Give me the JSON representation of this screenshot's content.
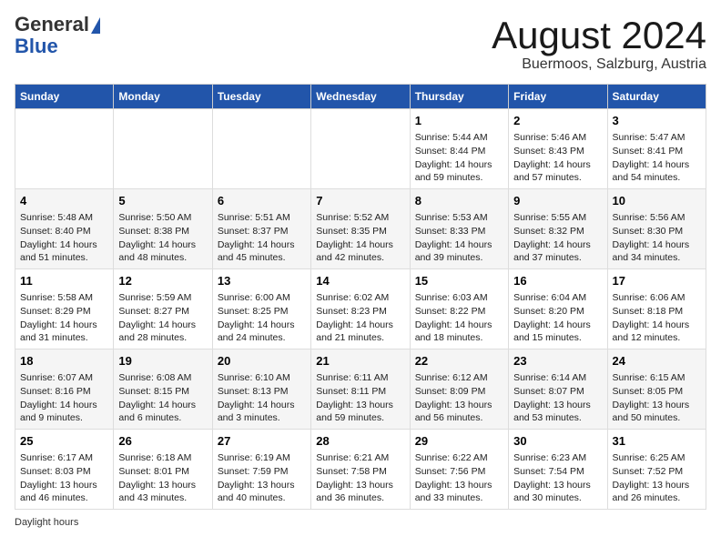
{
  "logo": {
    "general": "General",
    "blue": "Blue"
  },
  "title": "August 2024",
  "subtitle": "Buermoos, Salzburg, Austria",
  "days_of_week": [
    "Sunday",
    "Monday",
    "Tuesday",
    "Wednesday",
    "Thursday",
    "Friday",
    "Saturday"
  ],
  "footer_text": "Daylight hours",
  "weeks": [
    [
      {
        "day": "",
        "info": ""
      },
      {
        "day": "",
        "info": ""
      },
      {
        "day": "",
        "info": ""
      },
      {
        "day": "",
        "info": ""
      },
      {
        "day": "1",
        "info": "Sunrise: 5:44 AM\nSunset: 8:44 PM\nDaylight: 14 hours and 59 minutes."
      },
      {
        "day": "2",
        "info": "Sunrise: 5:46 AM\nSunset: 8:43 PM\nDaylight: 14 hours and 57 minutes."
      },
      {
        "day": "3",
        "info": "Sunrise: 5:47 AM\nSunset: 8:41 PM\nDaylight: 14 hours and 54 minutes."
      }
    ],
    [
      {
        "day": "4",
        "info": "Sunrise: 5:48 AM\nSunset: 8:40 PM\nDaylight: 14 hours and 51 minutes."
      },
      {
        "day": "5",
        "info": "Sunrise: 5:50 AM\nSunset: 8:38 PM\nDaylight: 14 hours and 48 minutes."
      },
      {
        "day": "6",
        "info": "Sunrise: 5:51 AM\nSunset: 8:37 PM\nDaylight: 14 hours and 45 minutes."
      },
      {
        "day": "7",
        "info": "Sunrise: 5:52 AM\nSunset: 8:35 PM\nDaylight: 14 hours and 42 minutes."
      },
      {
        "day": "8",
        "info": "Sunrise: 5:53 AM\nSunset: 8:33 PM\nDaylight: 14 hours and 39 minutes."
      },
      {
        "day": "9",
        "info": "Sunrise: 5:55 AM\nSunset: 8:32 PM\nDaylight: 14 hours and 37 minutes."
      },
      {
        "day": "10",
        "info": "Sunrise: 5:56 AM\nSunset: 8:30 PM\nDaylight: 14 hours and 34 minutes."
      }
    ],
    [
      {
        "day": "11",
        "info": "Sunrise: 5:58 AM\nSunset: 8:29 PM\nDaylight: 14 hours and 31 minutes."
      },
      {
        "day": "12",
        "info": "Sunrise: 5:59 AM\nSunset: 8:27 PM\nDaylight: 14 hours and 28 minutes."
      },
      {
        "day": "13",
        "info": "Sunrise: 6:00 AM\nSunset: 8:25 PM\nDaylight: 14 hours and 24 minutes."
      },
      {
        "day": "14",
        "info": "Sunrise: 6:02 AM\nSunset: 8:23 PM\nDaylight: 14 hours and 21 minutes."
      },
      {
        "day": "15",
        "info": "Sunrise: 6:03 AM\nSunset: 8:22 PM\nDaylight: 14 hours and 18 minutes."
      },
      {
        "day": "16",
        "info": "Sunrise: 6:04 AM\nSunset: 8:20 PM\nDaylight: 14 hours and 15 minutes."
      },
      {
        "day": "17",
        "info": "Sunrise: 6:06 AM\nSunset: 8:18 PM\nDaylight: 14 hours and 12 minutes."
      }
    ],
    [
      {
        "day": "18",
        "info": "Sunrise: 6:07 AM\nSunset: 8:16 PM\nDaylight: 14 hours and 9 minutes."
      },
      {
        "day": "19",
        "info": "Sunrise: 6:08 AM\nSunset: 8:15 PM\nDaylight: 14 hours and 6 minutes."
      },
      {
        "day": "20",
        "info": "Sunrise: 6:10 AM\nSunset: 8:13 PM\nDaylight: 14 hours and 3 minutes."
      },
      {
        "day": "21",
        "info": "Sunrise: 6:11 AM\nSunset: 8:11 PM\nDaylight: 13 hours and 59 minutes."
      },
      {
        "day": "22",
        "info": "Sunrise: 6:12 AM\nSunset: 8:09 PM\nDaylight: 13 hours and 56 minutes."
      },
      {
        "day": "23",
        "info": "Sunrise: 6:14 AM\nSunset: 8:07 PM\nDaylight: 13 hours and 53 minutes."
      },
      {
        "day": "24",
        "info": "Sunrise: 6:15 AM\nSunset: 8:05 PM\nDaylight: 13 hours and 50 minutes."
      }
    ],
    [
      {
        "day": "25",
        "info": "Sunrise: 6:17 AM\nSunset: 8:03 PM\nDaylight: 13 hours and 46 minutes."
      },
      {
        "day": "26",
        "info": "Sunrise: 6:18 AM\nSunset: 8:01 PM\nDaylight: 13 hours and 43 minutes."
      },
      {
        "day": "27",
        "info": "Sunrise: 6:19 AM\nSunset: 7:59 PM\nDaylight: 13 hours and 40 minutes."
      },
      {
        "day": "28",
        "info": "Sunrise: 6:21 AM\nSunset: 7:58 PM\nDaylight: 13 hours and 36 minutes."
      },
      {
        "day": "29",
        "info": "Sunrise: 6:22 AM\nSunset: 7:56 PM\nDaylight: 13 hours and 33 minutes."
      },
      {
        "day": "30",
        "info": "Sunrise: 6:23 AM\nSunset: 7:54 PM\nDaylight: 13 hours and 30 minutes."
      },
      {
        "day": "31",
        "info": "Sunrise: 6:25 AM\nSunset: 7:52 PM\nDaylight: 13 hours and 26 minutes."
      }
    ]
  ]
}
